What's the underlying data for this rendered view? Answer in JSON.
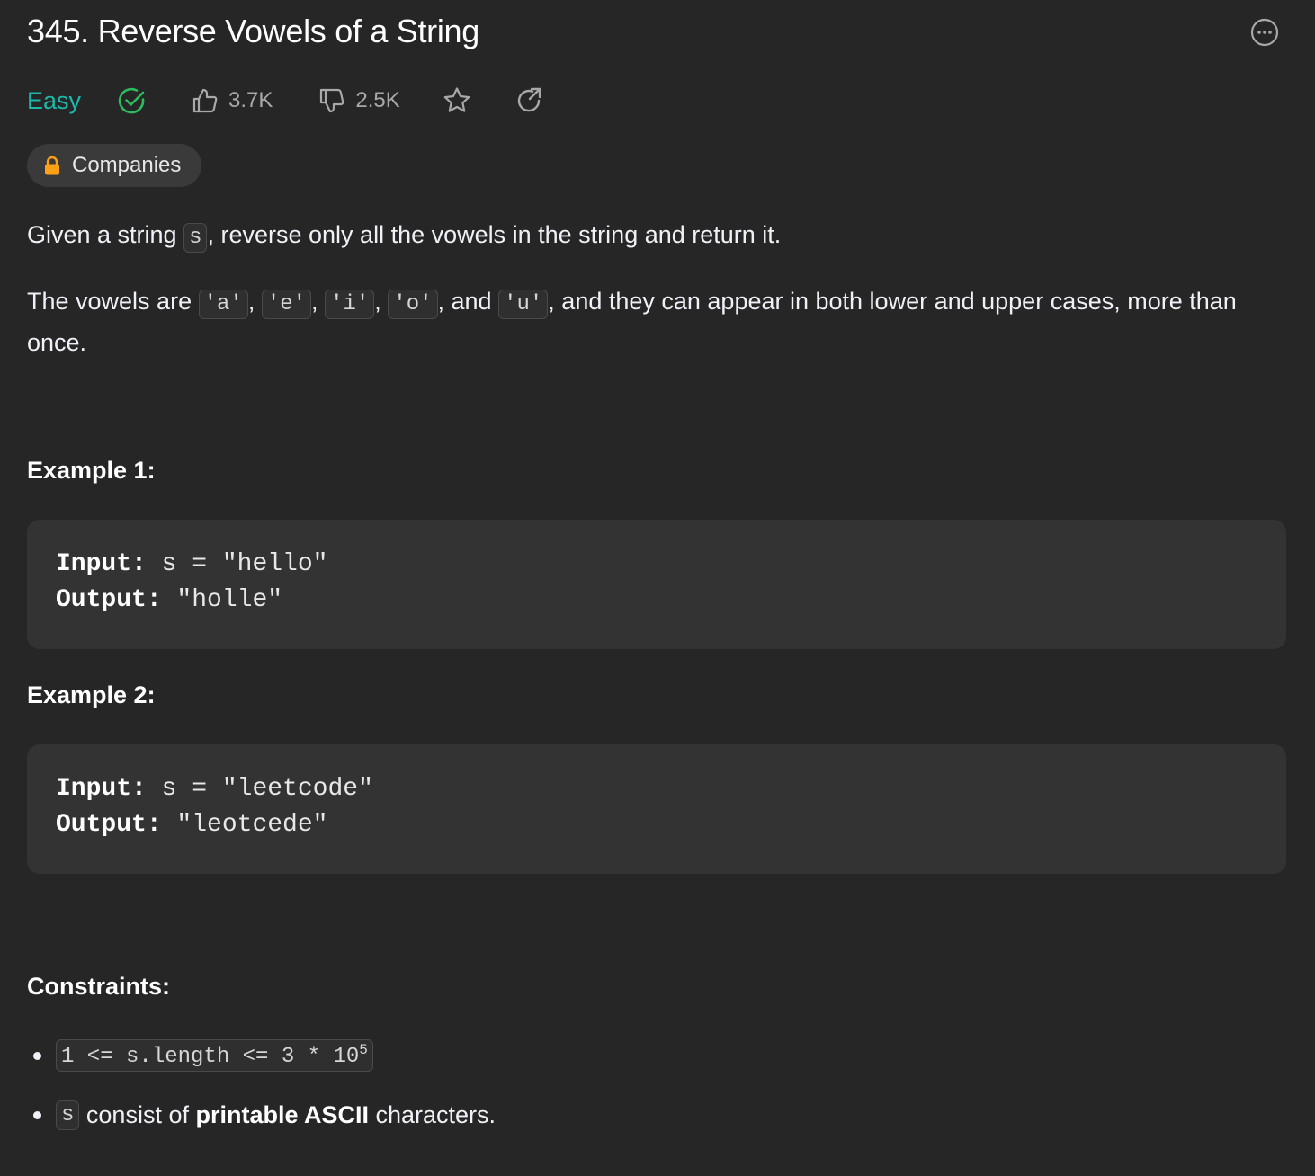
{
  "problem": {
    "title": "345. Reverse Vowels of a String",
    "difficulty": "Easy",
    "likes": "3.7K",
    "dislikes": "2.5K",
    "companies_label": "Companies"
  },
  "description": {
    "p1_before": "Given a string ",
    "p1_code": "s",
    "p1_after": ", reverse only all the vowels in the string and return it.",
    "p2_before": "The vowels are ",
    "vowels": [
      "'a'",
      "'e'",
      "'i'",
      "'o'",
      "'u'"
    ],
    "sep_comma": ", ",
    "sep_and": ", and ",
    "p2_after": ", and they can appear in both lower and upper cases, more than once."
  },
  "examples": [
    {
      "heading": "Example 1:",
      "input_label": "Input:",
      "input_value": " s = \"hello\"",
      "output_label": "Output:",
      "output_value": " \"holle\""
    },
    {
      "heading": "Example 2:",
      "input_label": "Input:",
      "input_value": " s = \"leetcode\"",
      "output_label": "Output:",
      "output_value": " \"leotcede\""
    }
  ],
  "constraints": {
    "heading": "Constraints:",
    "c1_code": "1 <= s.length <= 3 * 10",
    "c1_exp": "5",
    "c2_code": "s",
    "c2_mid": " consist of ",
    "c2_bold": "printable ASCII",
    "c2_end": " characters."
  },
  "colors": {
    "background": "#262626",
    "easy": "#1cb8a8",
    "solved_check": "#2cbb5d",
    "lock": "#ffa116"
  },
  "icons": [
    "more-icon",
    "solved-check-icon",
    "thumbs-up-icon",
    "thumbs-down-icon",
    "star-icon",
    "share-icon",
    "lock-icon"
  ]
}
